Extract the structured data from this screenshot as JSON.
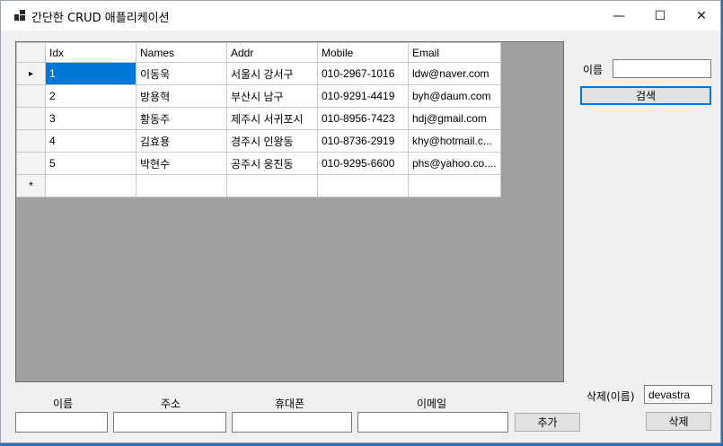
{
  "window": {
    "title": "간단한 CRUD 애플리케이션",
    "minimize": "—",
    "maximize": "☐",
    "close": "✕"
  },
  "grid": {
    "columns": [
      "Idx",
      "Names",
      "Addr",
      "Mobile",
      "Email"
    ],
    "rows": [
      [
        "1",
        "이동욱",
        "서울시 강서구",
        "010-2967-1016",
        "ldw@naver.com"
      ],
      [
        "2",
        "방용혁",
        "부산시 남구",
        "010-9291-4419",
        "byh@daum.com"
      ],
      [
        "3",
        "황동주",
        "제주시 서귀포시",
        "010-8956-7423",
        "hdj@gmail.com"
      ],
      [
        "4",
        "김효용",
        "경주시 인왕동",
        "010-8736-2919",
        "khy@hotmail.c..."
      ],
      [
        "5",
        "박현수",
        "공주시 웅진동",
        "010-9295-6600",
        "phs@yahoo.co...."
      ]
    ],
    "current_row_marker": "▸",
    "new_row_marker": "*"
  },
  "search": {
    "label": "이름",
    "value": "",
    "button": "검색"
  },
  "add_form": {
    "name_label": "이름",
    "addr_label": "주소",
    "phone_label": "휴대폰",
    "email_label": "이메일",
    "name_value": "",
    "addr_value": "",
    "phone_value": "",
    "email_value": "",
    "add_button": "추가"
  },
  "delete": {
    "label": "삭제(이름)",
    "value": "devastra",
    "button": "삭제"
  },
  "colors": {
    "accent": "#0078d7",
    "grid_bg": "#a0a0a0"
  }
}
